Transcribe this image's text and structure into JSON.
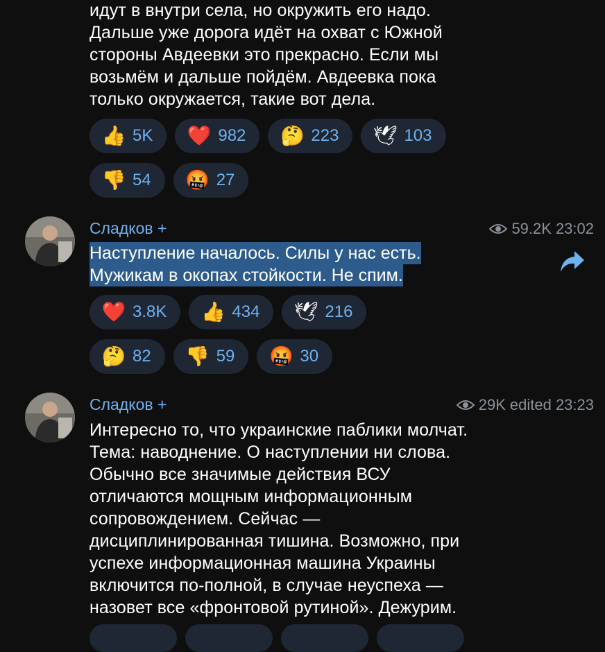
{
  "messages": [
    {
      "text": "идут в внутри села, но окружить его надо.\nДальше уже дорога идёт на охват с Южной\nстороны Авдеевки это прекрасно. Если мы\nвозьмём и дальше пойдём. Авдеевка пока\nтолько окружается, такие вот дела.",
      "reactions": [
        {
          "icon": "thumbs-up",
          "glyph": "👍",
          "count": "5K"
        },
        {
          "icon": "heart",
          "glyph": "❤️",
          "count": "982"
        },
        {
          "icon": "thinking-face",
          "glyph": "🤔",
          "count": "223"
        },
        {
          "icon": "dove",
          "glyph": "🕊",
          "count": "103"
        },
        {
          "icon": "thumbs-down",
          "glyph": "👎",
          "count": "54"
        },
        {
          "icon": "cursing-face",
          "glyph": "🤬",
          "count": "27"
        }
      ]
    },
    {
      "author": "Сладков +",
      "views": "59.2K",
      "time": "23:02",
      "line1": "Наступление началось. Силы у нас есть.",
      "line2": "Мужикам в окопах стойкости. Не спим.",
      "reactions": [
        {
          "icon": "heart",
          "glyph": "❤️",
          "count": "3.8K"
        },
        {
          "icon": "thumbs-up",
          "glyph": "👍",
          "count": "434"
        },
        {
          "icon": "dove",
          "glyph": "🕊",
          "count": "216"
        },
        {
          "icon": "thinking-face",
          "glyph": "🤔",
          "count": "82"
        },
        {
          "icon": "thumbs-down",
          "glyph": "👎",
          "count": "59"
        },
        {
          "icon": "cursing-face",
          "glyph": "🤬",
          "count": "30"
        }
      ]
    },
    {
      "author": "Сладков +",
      "views": "29K",
      "time": "edited 23:23",
      "text": "Интересно то, что украинские паблики молчат.\nТема: наводнение. О наступлении ни слова.\nОбычно все значимые действия ВСУ\nотличаются мощным информационным\nсопровождением. Сейчас —\nдисциплинированная тишина. Возможно, при\nуспехе информационная машина Украины\nвключится по-полной, в случае неуспеха —\nназовет все «фронтовой рутиной». Дежурим."
    }
  ],
  "colors": {
    "background": "#0f0f0f",
    "accent": "#6fb2f2",
    "bubble": "#1e2733",
    "selection": "#2d5b8c",
    "meta": "#8a9199"
  }
}
